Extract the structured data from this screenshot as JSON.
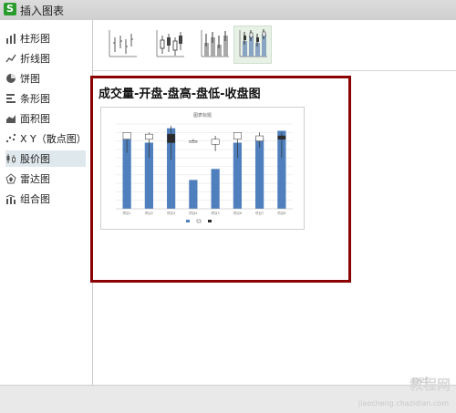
{
  "window": {
    "title": "插入图表"
  },
  "sidebar": {
    "items": [
      {
        "label": "柱形图",
        "icon": "column-chart-icon"
      },
      {
        "label": "折线图",
        "icon": "line-chart-icon"
      },
      {
        "label": "饼图",
        "icon": "pie-chart-icon"
      },
      {
        "label": "条形图",
        "icon": "bar-chart-icon"
      },
      {
        "label": "面积图",
        "icon": "area-chart-icon"
      },
      {
        "label": "X Y（散点图）",
        "icon": "scatter-chart-icon"
      },
      {
        "label": "股价图",
        "icon": "stock-chart-icon",
        "selected": true
      },
      {
        "label": "雷达图",
        "icon": "radar-chart-icon"
      },
      {
        "label": "组合图",
        "icon": "combo-chart-icon"
      }
    ]
  },
  "subtypes": [
    "stock-hlc-icon",
    "stock-ohlc-icon",
    "stock-vhlc-icon",
    "stock-vohlc-icon"
  ],
  "preview": {
    "label": "成交量-开盘-盘高-盘低-收盘图"
  },
  "chart_data": {
    "type": "bar",
    "title": "图表标题",
    "categories": [
      "项目1",
      "项目2",
      "项目3",
      "项目4",
      "项目5",
      "项目6",
      "项目7",
      "项目8"
    ],
    "series": [
      {
        "values": [
          82,
          78,
          95,
          34,
          47,
          78,
          84,
          92
        ]
      }
    ],
    "ohlc": [
      {
        "open": 82,
        "high": 90,
        "low": 66,
        "close": 90
      },
      {
        "open": 82,
        "high": 90,
        "low": 60,
        "close": 88
      },
      {
        "open": 88,
        "high": 98,
        "low": 58,
        "close": 78
      },
      {
        "open": 80,
        "high": 82,
        "low": 78,
        "close": 80
      },
      {
        "open": 76,
        "high": 86,
        "low": 68,
        "close": 82
      },
      {
        "open": 82,
        "high": 90,
        "low": 60,
        "close": 90
      },
      {
        "open": 80,
        "high": 90,
        "low": 72,
        "close": 86
      },
      {
        "open": 86,
        "high": 90,
        "low": 60,
        "close": 82
      }
    ],
    "ylim": [
      0,
      100
    ],
    "legend_position": "bottom",
    "grid": true,
    "colors": {
      "bar": "#4f7fbd",
      "down_candle": "#2b2b2b",
      "up_candle": "#ffffff",
      "wick": "#333333"
    }
  },
  "watermark": {
    "line1": "教程网",
    "line2": "jiaocheng.chazidian.com",
    "line3": "net"
  }
}
